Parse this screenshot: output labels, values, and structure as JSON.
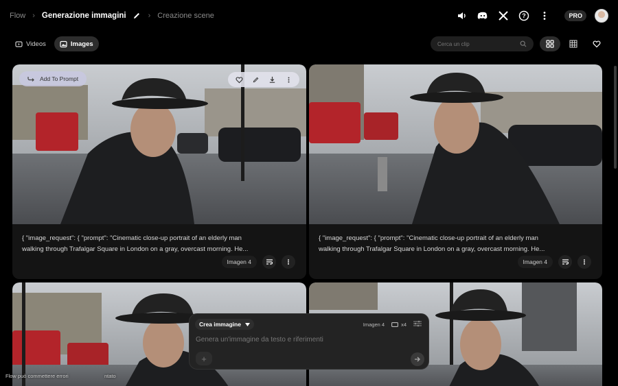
{
  "breadcrumb": {
    "root": "Flow",
    "project": "Generazione immagini",
    "scene": "Creazione scene"
  },
  "header": {
    "icons": [
      "volume-icon",
      "discord-icon",
      "x-icon",
      "help-icon",
      "more-vertical-icon"
    ],
    "plan_badge": "PRO"
  },
  "toolbar": {
    "tab_videos": "Videos",
    "tab_images": "Images",
    "active_tab": "Images",
    "search_placeholder": "Cerca un clip"
  },
  "cards": [
    {
      "caption_line1": "{ \"image_request\": { \"prompt\": \"Cinematic close-up portrait of an elderly man",
      "caption_line2": "walking through Trafalgar Square in London on a gray, overcast morning. He...",
      "model": "Imagen 4"
    },
    {
      "caption_line1": "{ \"image_request\": { \"prompt\": \"Cinematic close-up portrait of an elderly man",
      "caption_line2": "walking through Trafalgar Square in London on a gray, overcast morning. He...",
      "model": "Imagen 4"
    }
  ],
  "hover_overlay": {
    "add_to_prompt": "Add To Prompt"
  },
  "prompt_box": {
    "mode": "Crea immagine",
    "model": "Imagen 4",
    "count": "x4",
    "placeholder": "Genera un'immagine da testo e riferimenti",
    "add_symbol": "+"
  },
  "footer": {
    "disclaimer": "Flow può commettere errori",
    "disclaimer_tail": "ntato"
  },
  "colors": {
    "background": "#000000",
    "card": "#141414",
    "overlay_add": "#c8c8e1"
  }
}
